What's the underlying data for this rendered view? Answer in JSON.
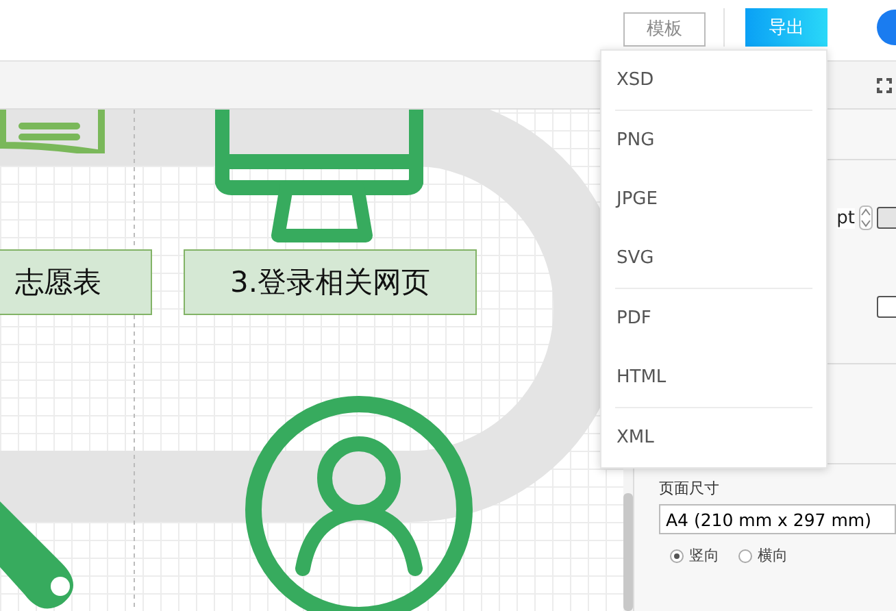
{
  "header": {
    "buttons": [
      {
        "label": "模板",
        "kind": "outline"
      },
      {
        "label": "导出",
        "kind": "primary"
      }
    ]
  },
  "export_menu": {
    "open": true,
    "groups": [
      [
        "XSD"
      ],
      [
        "PNG",
        "JPGE",
        "SVG"
      ],
      [
        "PDF",
        "HTML"
      ],
      [
        "XML"
      ]
    ]
  },
  "canvas": {
    "nodes": [
      {
        "label": "志愿表"
      },
      {
        "label": "3.登录相关网页"
      }
    ]
  },
  "panel": {
    "fields": [
      {
        "unit": "pt"
      }
    ],
    "page_size": {
      "label": "页面尺寸",
      "value": "A4 (210 mm x 297 mm)"
    },
    "orientation": [
      {
        "label": "竖向",
        "selected": true
      },
      {
        "label": "横向",
        "selected": false
      }
    ]
  }
}
